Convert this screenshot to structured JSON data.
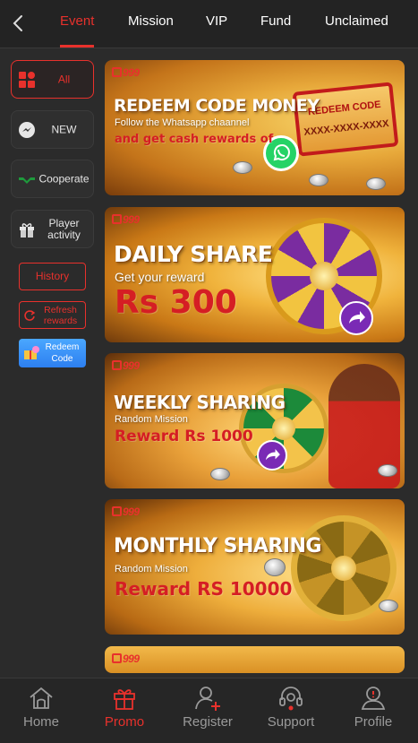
{
  "top_tabs": [
    {
      "label": "Event",
      "active": true
    },
    {
      "label": "Mission",
      "active": false
    },
    {
      "label": "VIP",
      "active": false
    },
    {
      "label": "Fund",
      "active": false
    },
    {
      "label": "Unclaimed",
      "active": false
    }
  ],
  "sidebar": {
    "items": [
      {
        "label": "All",
        "icon": "grid-icon",
        "active": true
      },
      {
        "label": "NEW",
        "icon": "messenger-icon",
        "active": false
      },
      {
        "label": "Cooperate",
        "icon": "handshake-icon",
        "active": false
      },
      {
        "label": "Player activity",
        "icon": "gift-icon",
        "active": false
      }
    ],
    "history_label": "History",
    "refresh_label": "Refresh rewards",
    "redeem_label": "Redeem Code"
  },
  "banners": [
    {
      "brand": "999",
      "title": "REDEEM CODE MONEY",
      "line1": "Follow the Whatsapp chaannel",
      "line2": "and get cash rewards of",
      "ticket_title": "REDEEM CODE",
      "ticket_code": "XXXX-XXXX-XXXX"
    },
    {
      "brand": "999",
      "title": "DAILY SHARE",
      "line1": "Get your reward",
      "line2": "Rs 300"
    },
    {
      "brand": "999",
      "title": "WEEKLY SHARING",
      "line1": "Random Mission",
      "line2": "Reward Rs 1000"
    },
    {
      "brand": "999",
      "title": "MONTHLY SHARING",
      "line1": "Random Mission",
      "line2": "Reward RS 10000"
    },
    {
      "brand": "999"
    }
  ],
  "bottom_nav": [
    {
      "label": "Home",
      "icon": "home-icon",
      "active": false
    },
    {
      "label": "Promo",
      "icon": "gift-icon",
      "active": true
    },
    {
      "label": "Register",
      "icon": "add-user-icon",
      "active": false
    },
    {
      "label": "Support",
      "icon": "headset-icon",
      "active": false
    },
    {
      "label": "Profile",
      "icon": "profile-icon",
      "active": false
    }
  ],
  "colors": {
    "accent": "#e8312c",
    "background": "#2b2b2b",
    "redeem_blue": "#3a92f5"
  }
}
